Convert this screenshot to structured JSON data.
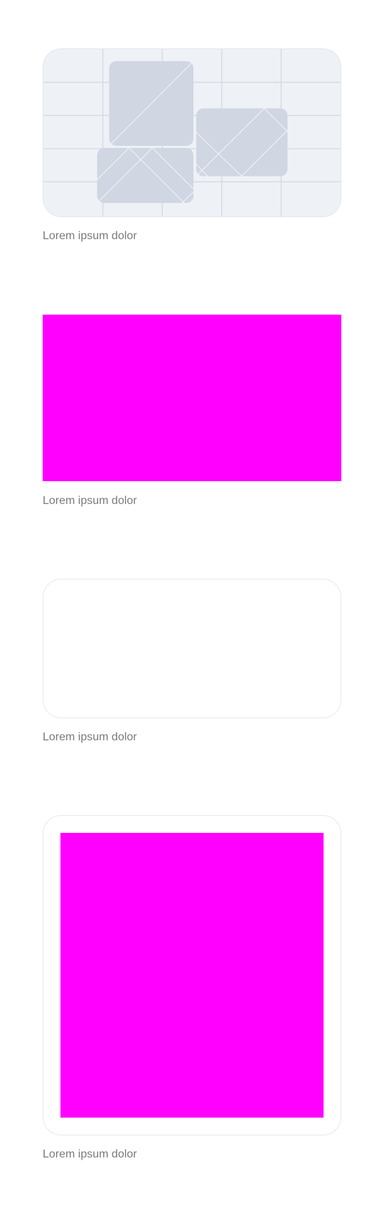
{
  "items": [
    {
      "caption": "Lorem ipsum dolor"
    },
    {
      "caption": "Lorem ipsum dolor"
    },
    {
      "caption": "Lorem ipsum dolor"
    },
    {
      "caption": "Lorem ipsum dolor"
    }
  ],
  "colors": {
    "background": "#ffffff",
    "placeholder_bg": "#eef1f6",
    "placeholder_shape": "#d0d6e2",
    "placeholder_grid": "#d6dbe3",
    "magenta": "#ff00ff",
    "caption_text": "#7a7a7a",
    "card_border": "#e6e8ed"
  }
}
